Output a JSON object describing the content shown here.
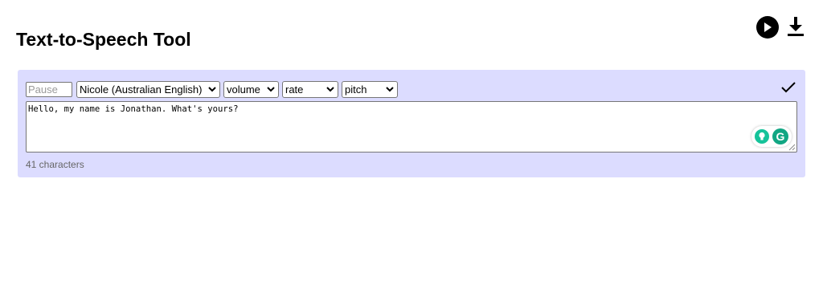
{
  "header": {
    "title": "Text-to-Speech Tool",
    "play_icon": "play-circle-icon",
    "download_icon": "download-icon"
  },
  "editor": {
    "pause_placeholder": "Pause",
    "pause_value": "",
    "voice_selected": "Nicole (Australian English)",
    "volume_selected": "volume",
    "rate_selected": "rate",
    "pitch_selected": "pitch",
    "confirm_icon": "checkmark-icon",
    "text": "Hello, my name is Jonathan. What's yours?",
    "char_count": "41 characters",
    "grammarly_logo": "G"
  },
  "colors": {
    "panel_bg": "#dcdcff",
    "grammarly_green": "#15c39a"
  }
}
